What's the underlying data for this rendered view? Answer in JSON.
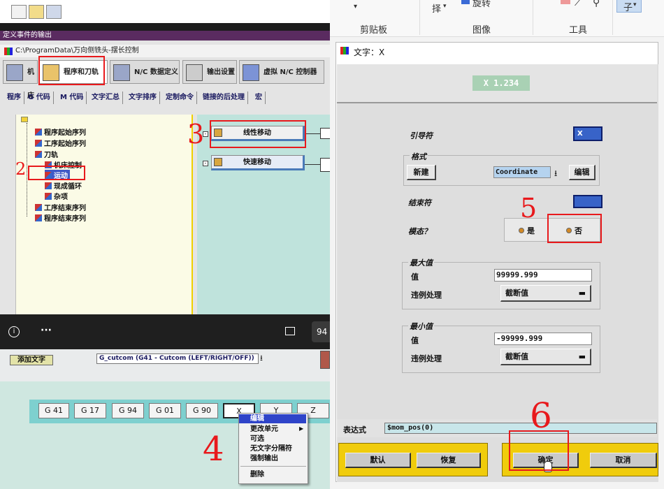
{
  "left": {
    "define_title": "定义事件的输出",
    "path": "C:\\ProgramData\\万向侧铣头-摆长控制",
    "main_tabs": [
      "机床",
      "程序和刀轨",
      "N/C 数据定义",
      "输出设置",
      "虚拟 N/C 控制器"
    ],
    "sub_tabs": [
      "程序",
      "G 代码",
      "M 代码",
      "文字汇总",
      "文字排序",
      "定制命令",
      "链接的后处理",
      "宏"
    ],
    "tree": [
      "程序起始序列",
      "工序起始序列",
      "刀轨",
      "机床控制",
      "运动",
      "现成循环",
      "杂项",
      "工序结束序列",
      "程序结束序列"
    ],
    "flow_buttons": [
      "线性移动",
      "快速移动"
    ],
    "video_zoom": "94",
    "add_text": "添加文字",
    "gcode_select": "G_cutcom (G41 - Cutcom (LEFT/RIGHT/OFF))",
    "gcells": [
      "G 41",
      "G 17",
      "G 94",
      "G 01",
      "G 90",
      "X",
      "Y",
      "Z"
    ],
    "context_menu": [
      "编辑",
      "更改单元",
      "可选",
      "无文字分隔符",
      "强制输出",
      "删除"
    ],
    "annotations": [
      "2",
      "3",
      "4"
    ]
  },
  "ribbon": {
    "select_label": "择",
    "rotate_label": "旋转",
    "groups": [
      "剪贴板",
      "图像",
      "工具"
    ],
    "sub_label": "子"
  },
  "dialog": {
    "title": "文字：X",
    "display": "X  1.234",
    "leader_label": "引导符",
    "leader_value": "X",
    "format_group": "格式",
    "new_button": "新建",
    "format_value": "Coordinate",
    "edit_button": "编辑",
    "trailer_label": "结束符",
    "modal_label": "模态？",
    "modal_yes": "是",
    "modal_no": "否",
    "max_group": "最大值",
    "max_value_label": "值",
    "max_value": "99999.999",
    "max_violation_label": "违例处理",
    "max_violation_value": "截断值",
    "min_group": "最小值",
    "min_value_label": "值",
    "min_value": "-99999.999",
    "min_violation_label": "违例处理",
    "min_violation_value": "截断值",
    "expr_label": "表达式",
    "expr_value": "$mom_pos(0)",
    "buttons": [
      "默认",
      "恢复",
      "确定",
      "取消"
    ],
    "annotations": [
      "5",
      "6"
    ]
  }
}
